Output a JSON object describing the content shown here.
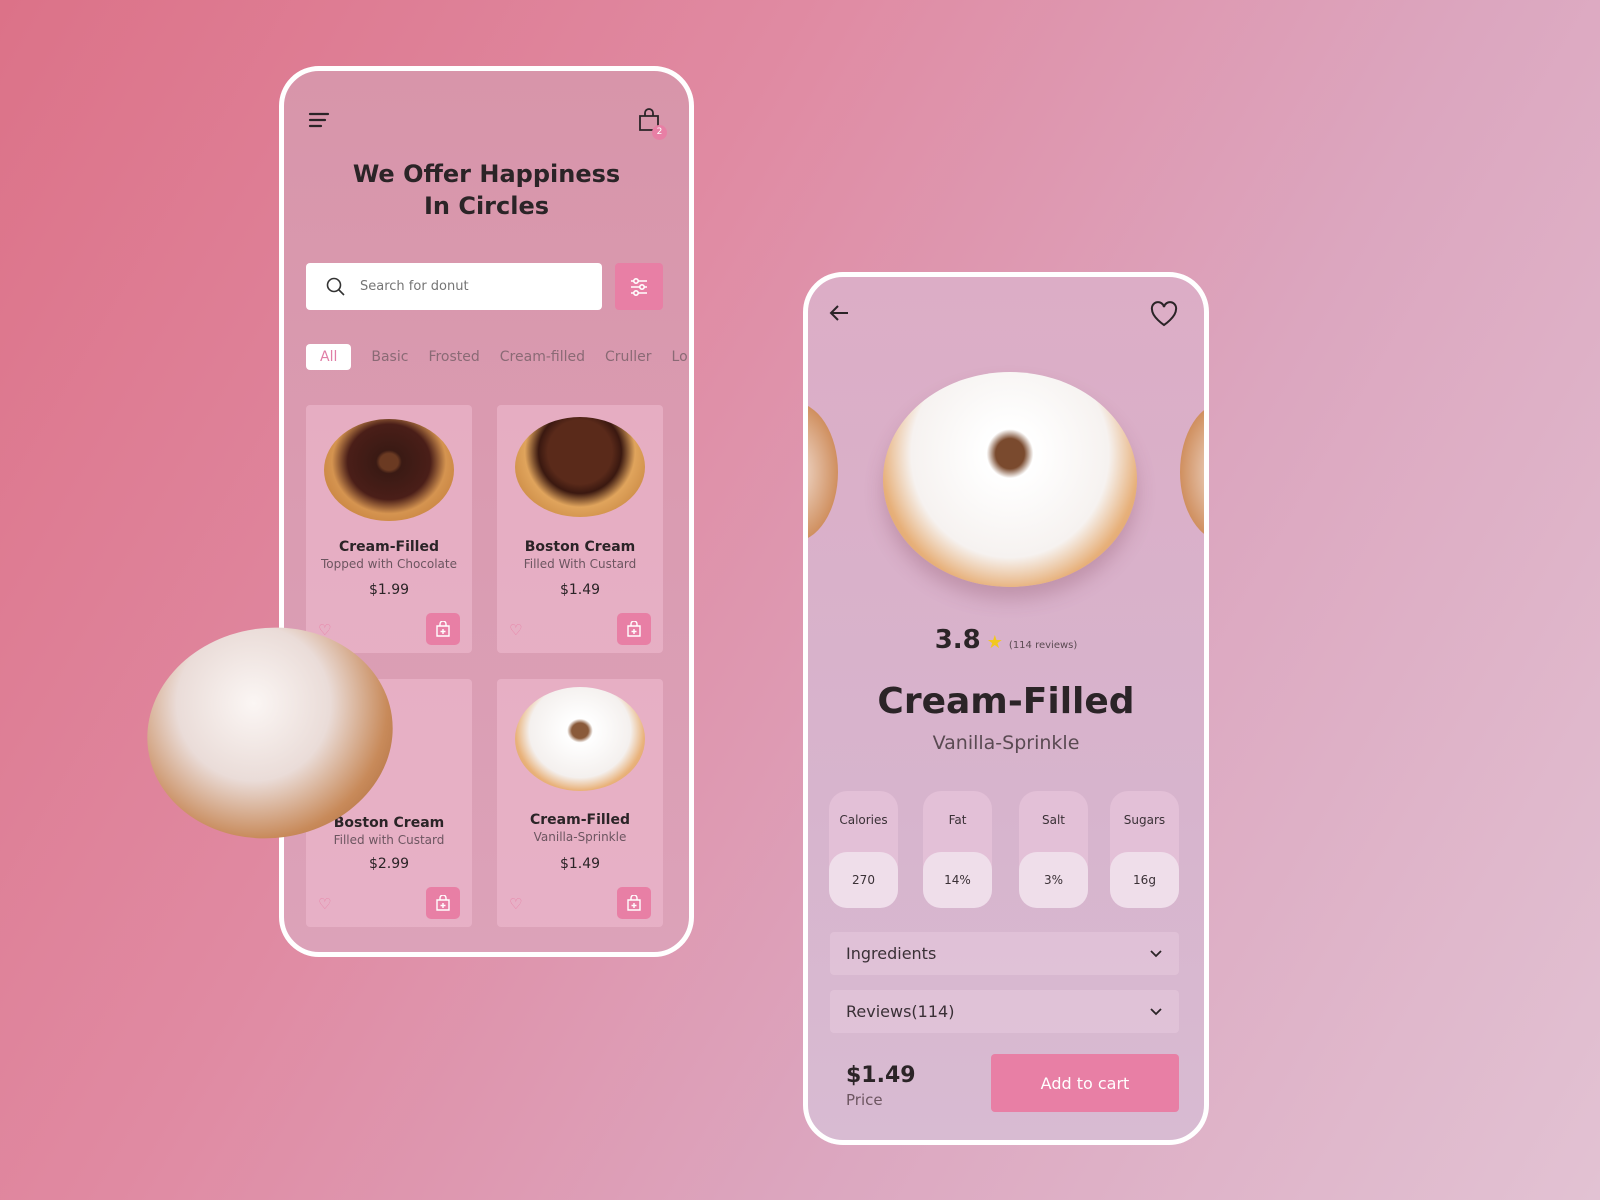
{
  "home": {
    "badge_count": "2",
    "title_line1": "We Offer Happiness",
    "title_line2": "In Circles",
    "search_placeholder": "Search for donut",
    "tabs": [
      "All",
      "Basic",
      "Frosted",
      "Cream-filled",
      "Cruller",
      "Lo"
    ],
    "products": [
      {
        "name": "Cream-Filled",
        "desc": "Topped with Chocolate",
        "price": "$1.99"
      },
      {
        "name": "Boston Cream",
        "desc": "Filled With Custard",
        "price": "$1.49"
      },
      {
        "name": "Boston Cream",
        "desc": "Filled with Custard",
        "price": "$2.99"
      },
      {
        "name": "Cream-Filled",
        "desc": "Vanilla-Sprinkle",
        "price": "$1.49"
      }
    ]
  },
  "detail": {
    "rating": "3.8",
    "reviews_text": "(114 reviews)",
    "title": "Cream-Filled",
    "subtitle": "Vanilla-Sprinkle",
    "nutrition": [
      {
        "label": "Calories",
        "value": "270"
      },
      {
        "label": "Fat",
        "value": "14%"
      },
      {
        "label": "Salt",
        "value": "3%"
      },
      {
        "label": "Sugars",
        "value": "16g"
      }
    ],
    "ingredients_label": "Ingredients",
    "reviews_label": "Reviews(114)",
    "price": "$1.49",
    "price_label": "Price",
    "add_to_cart": "Add to cart"
  },
  "colors": {
    "accent": "#e87fa5",
    "star": "#f2c81e"
  }
}
